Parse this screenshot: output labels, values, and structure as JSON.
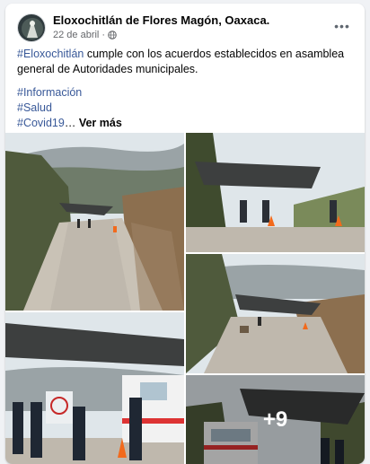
{
  "post": {
    "page_name": "Eloxochitlán de Flores Magón, Oaxaca.",
    "date": "22 de abril",
    "separator": "·",
    "privacy_icon": "globe-icon",
    "more_label": "•••",
    "body": {
      "hashtag_main": "#Eloxochitlán",
      "text_rest": " cumple con los acuerdos establecidos en asamblea general de Autoridades municipales.",
      "tags": [
        "#Información",
        "#Salud",
        "#Covid19"
      ],
      "ellipsis": "…",
      "see_more": "Ver más"
    }
  },
  "photos": {
    "count": 5,
    "more_count_label": "+9"
  },
  "colors": {
    "link": "#385898",
    "secondary_text": "#65676b",
    "tarp": "#3d3f3f",
    "road": "#bfb8ad",
    "sky": "#dfe6ea",
    "cone": "#f26a1c"
  }
}
